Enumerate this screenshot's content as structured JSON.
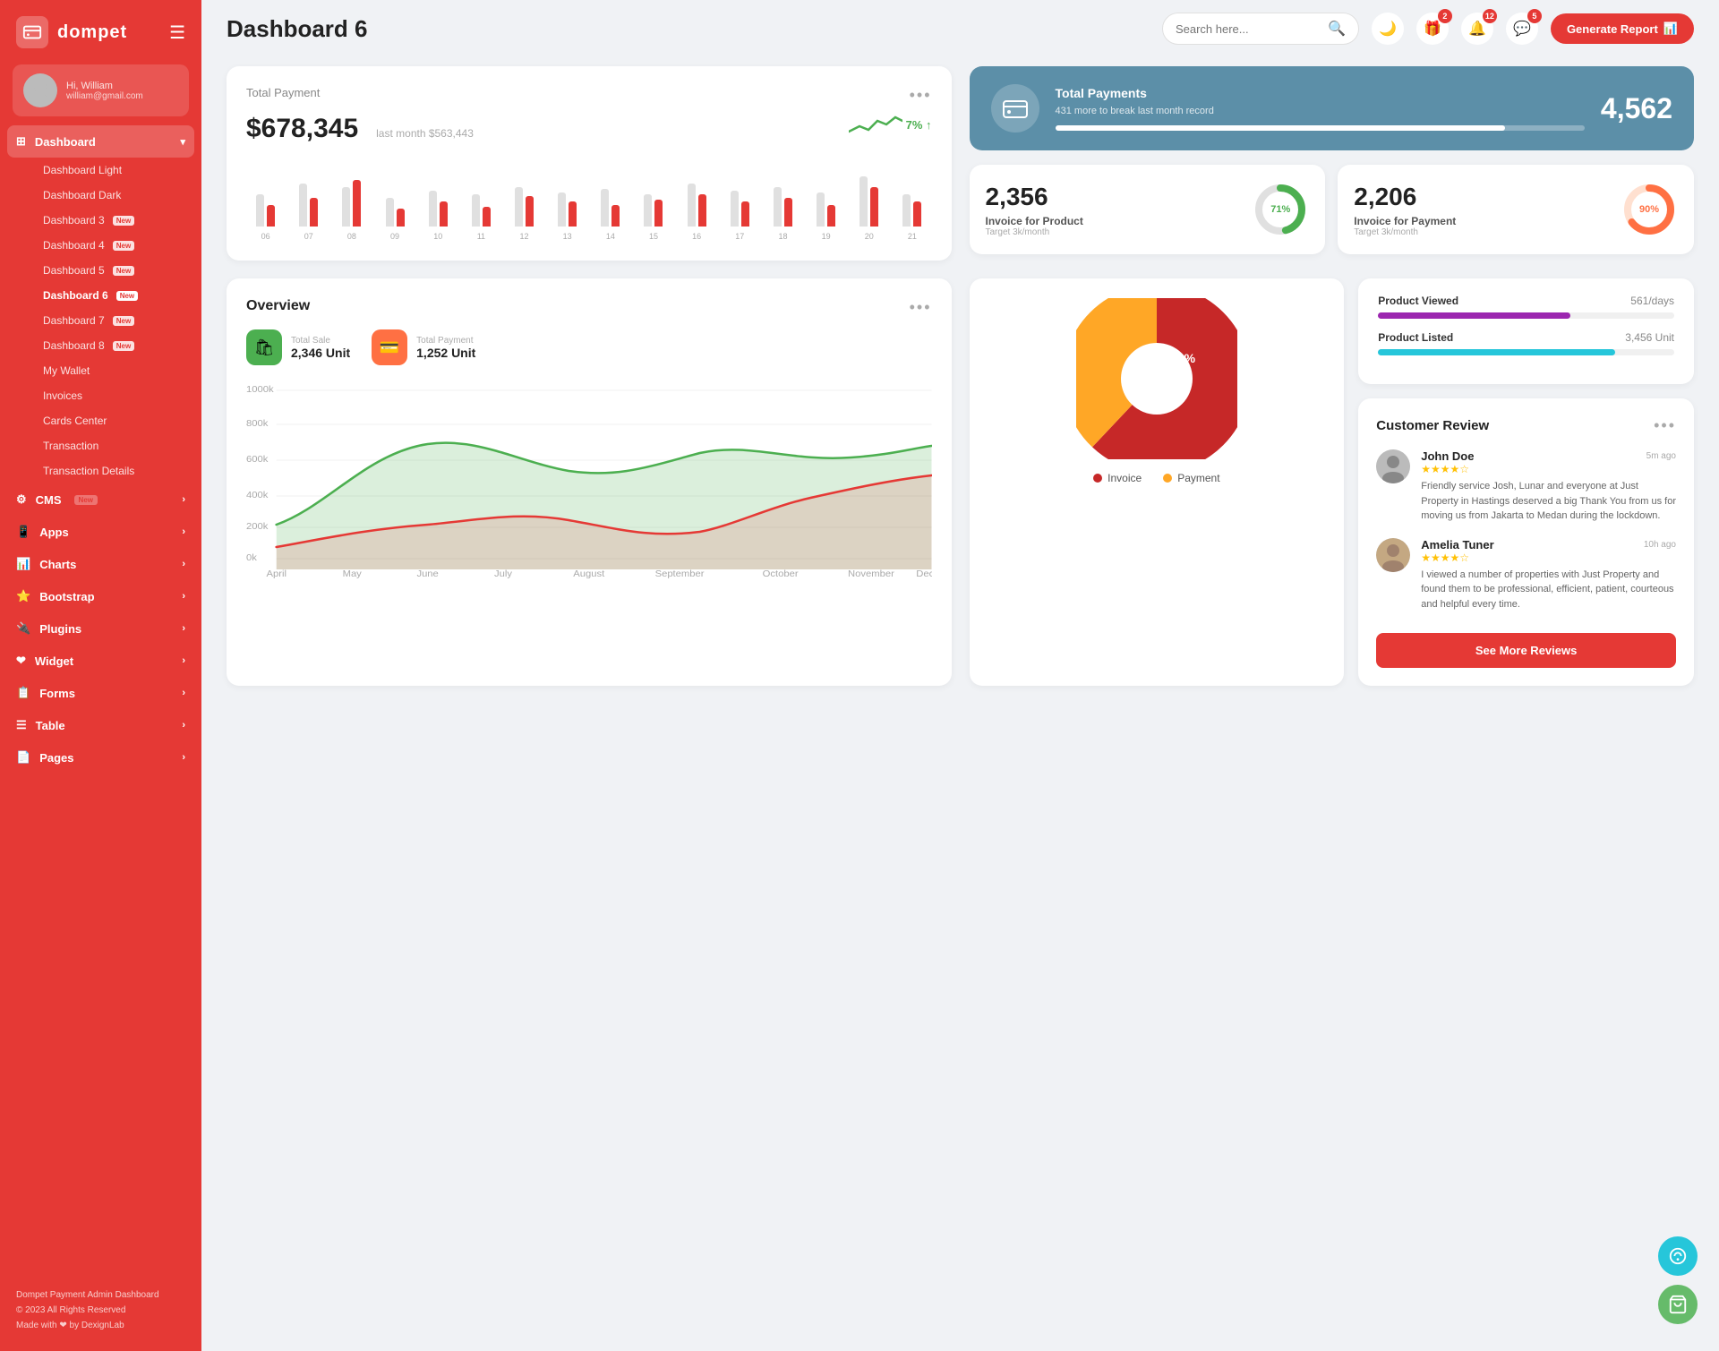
{
  "app": {
    "name": "dompet",
    "logo_icon": "💳"
  },
  "user": {
    "greeting": "Hi, William",
    "email": "william@gmail.com",
    "avatar": "👤"
  },
  "topbar": {
    "page_title": "Dashboard 6",
    "search_placeholder": "Search here...",
    "generate_report_label": "Generate Report",
    "badges": {
      "gift": "2",
      "bell": "12",
      "chat": "5"
    }
  },
  "sidebar": {
    "nav_items": [
      {
        "label": "Dashboard",
        "icon": "⊞",
        "has_arrow": true,
        "active": true
      },
      {
        "label": "CMS",
        "icon": "⚙",
        "has_arrow": true,
        "badge": "New"
      },
      {
        "label": "Apps",
        "icon": "📱",
        "has_arrow": true
      },
      {
        "label": "Charts",
        "icon": "📊",
        "has_arrow": true
      },
      {
        "label": "Bootstrap",
        "icon": "⭐",
        "has_arrow": true
      },
      {
        "label": "Plugins",
        "icon": "🔌",
        "has_arrow": true
      },
      {
        "label": "Widget",
        "icon": "❤",
        "has_arrow": true
      },
      {
        "label": "Forms",
        "icon": "📋",
        "has_arrow": true
      },
      {
        "label": "Table",
        "icon": "☰",
        "has_arrow": true
      },
      {
        "label": "Pages",
        "icon": "📄",
        "has_arrow": true
      }
    ],
    "sub_items": [
      {
        "label": "Dashboard Light"
      },
      {
        "label": "Dashboard Dark"
      },
      {
        "label": "Dashboard 3",
        "badge": "New"
      },
      {
        "label": "Dashboard 4",
        "badge": "New"
      },
      {
        "label": "Dashboard 5",
        "badge": "New"
      },
      {
        "label": "Dashboard 6",
        "badge": "New",
        "active": true
      },
      {
        "label": "Dashboard 7",
        "badge": "New"
      },
      {
        "label": "Dashboard 8",
        "badge": "New"
      },
      {
        "label": "My Wallet"
      },
      {
        "label": "Invoices"
      },
      {
        "label": "Cards Center"
      },
      {
        "label": "Transaction"
      },
      {
        "label": "Transaction Details"
      }
    ],
    "footer": {
      "title": "Dompet Payment Admin Dashboard",
      "copy": "© 2023 All Rights Reserved",
      "made_with": "Made with ❤ by DexignLab"
    }
  },
  "total_payment": {
    "label": "Total Payment",
    "amount": "$678,345",
    "last_month": "last month $563,443",
    "trend": "7%",
    "bars": [
      {
        "label": "06",
        "light": 45,
        "red": 30
      },
      {
        "label": "07",
        "light": 60,
        "red": 40
      },
      {
        "label": "08",
        "light": 55,
        "red": 65
      },
      {
        "label": "09",
        "light": 40,
        "red": 25
      },
      {
        "label": "10",
        "light": 50,
        "red": 35
      },
      {
        "label": "11",
        "light": 45,
        "red": 28
      },
      {
        "label": "12",
        "light": 55,
        "red": 42
      },
      {
        "label": "13",
        "light": 48,
        "red": 35
      },
      {
        "label": "14",
        "light": 52,
        "red": 30
      },
      {
        "label": "15",
        "light": 45,
        "red": 38
      },
      {
        "label": "16",
        "light": 60,
        "red": 45
      },
      {
        "label": "17",
        "light": 50,
        "red": 35
      },
      {
        "label": "18",
        "light": 55,
        "red": 40
      },
      {
        "label": "19",
        "light": 48,
        "red": 30
      },
      {
        "label": "20",
        "light": 70,
        "red": 55
      },
      {
        "label": "21",
        "light": 45,
        "red": 35
      }
    ]
  },
  "stat_banner": {
    "icon": "👛",
    "title": "Total Payments",
    "sub": "431 more to break last month record",
    "number": "4,562",
    "progress": 85
  },
  "stat_cards": [
    {
      "num": "2,356",
      "name": "Invoice for Product",
      "target": "Target 3k/month",
      "percent": 71,
      "color": "#4caf50"
    },
    {
      "num": "2,206",
      "name": "Invoice for Payment",
      "target": "Target 3k/month",
      "percent": 90,
      "color": "#ff7043"
    }
  ],
  "overview": {
    "title": "Overview",
    "total_sale": {
      "label": "Total Sale",
      "value": "2,346 Unit",
      "icon": "🛍"
    },
    "total_payment": {
      "label": "Total Payment",
      "value": "1,252 Unit",
      "icon": "💳"
    },
    "chart": {
      "months": [
        "April",
        "May",
        "June",
        "July",
        "August",
        "September",
        "October",
        "November",
        "Dec."
      ],
      "y_labels": [
        "1000k",
        "800k",
        "600k",
        "400k",
        "200k",
        "0k"
      ]
    }
  },
  "pie_chart": {
    "invoice_pct": 62,
    "payment_pct": 38,
    "legend": [
      {
        "label": "Invoice",
        "color": "#c62828"
      },
      {
        "label": "Payment",
        "color": "#ffa726"
      }
    ]
  },
  "product_stats": [
    {
      "name": "Product Viewed",
      "value": "561/days",
      "progress": 65,
      "color": "#9c27b0"
    },
    {
      "name": "Product Listed",
      "value": "3,456 Unit",
      "progress": 80,
      "color": "#26c6da"
    }
  ],
  "customer_review": {
    "title": "Customer Review",
    "reviews": [
      {
        "name": "John Doe",
        "stars": 4,
        "time": "5m ago",
        "text": "Friendly service Josh, Lunar and everyone at Just Property in Hastings deserved a big Thank You from us for moving us from Jakarta to Medan during the lockdown.",
        "avatar": "👨"
      },
      {
        "name": "Amelia Tuner",
        "stars": 4,
        "time": "10h ago",
        "text": "I viewed a number of properties with Just Property and found them to be professional, efficient, patient, courteous and helpful every time.",
        "avatar": "👩"
      }
    ],
    "see_more_label": "See More Reviews"
  }
}
